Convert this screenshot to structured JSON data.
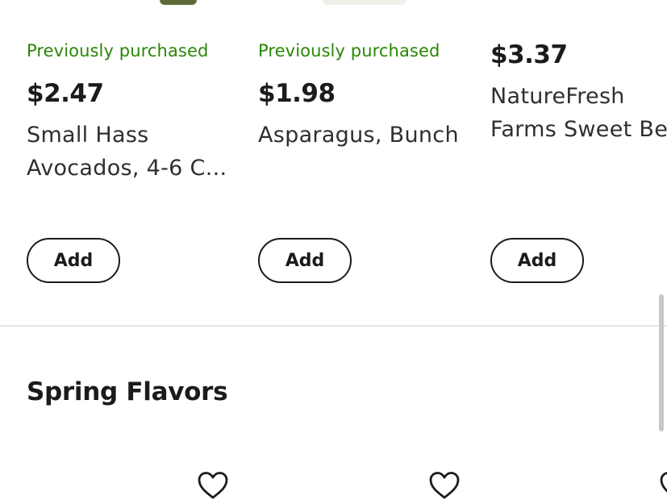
{
  "products": [
    {
      "badge": "Previously purchased",
      "price": "$2.47",
      "title_line1": "Small Hass",
      "title_line2": "Avocados, 4-6 C...",
      "add_label": "Add"
    },
    {
      "badge": "Previously purchased",
      "price": "$1.98",
      "title_line1": "Asparagus, Bunch",
      "title_line2": "",
      "add_label": "Add"
    },
    {
      "badge": "",
      "price": "$3.37",
      "title_line1": "NatureFresh",
      "title_line2": "Farms Sweet Be",
      "add_label": "Add"
    }
  ],
  "section": {
    "title": "Spring Flavors"
  },
  "icons": {
    "favorite": "heart-outline-icon"
  },
  "colors": {
    "badge_green": "#2a8703",
    "text_primary": "#1b1b1b",
    "divider": "#e3e4e5"
  }
}
